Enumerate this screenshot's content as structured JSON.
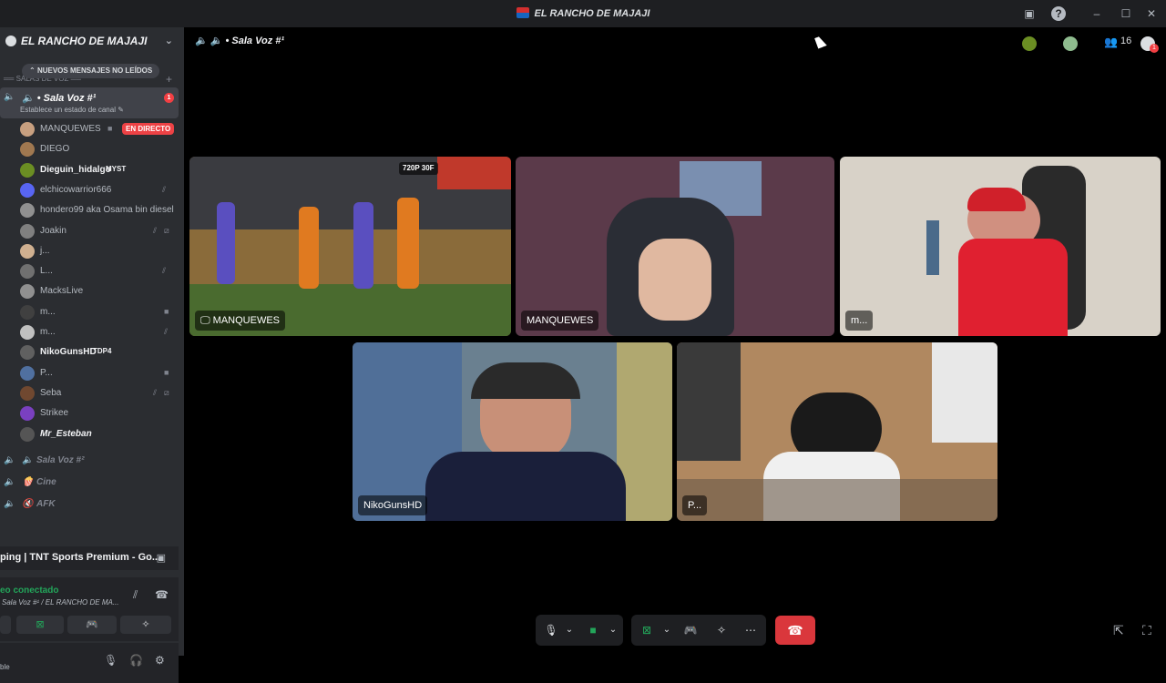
{
  "window": {
    "title": "EL RANCHO DE MAJAJI"
  },
  "sidebar": {
    "server_name": "EL RANCHO DE MAJAJI",
    "new_messages_pill": "NUEVOS MENSAJES NO LEÍDOS",
    "category": "SALAS DE VOZ",
    "active_channel": {
      "name": "Sala Voz #¹",
      "status_hint": "Establece un estado de canal",
      "badge": "1"
    },
    "members": [
      {
        "name": "MANQUEWES",
        "live": "EN DIRECTO"
      },
      {
        "name": "DIEGO"
      },
      {
        "name": "Dieguin_hidalgo",
        "tag": "MYST"
      },
      {
        "name": "elchicowarrior666"
      },
      {
        "name": "hondero99 aka Osama bin diesel"
      },
      {
        "name": "Joakin"
      },
      {
        "name": "j..."
      },
      {
        "name": "L..."
      },
      {
        "name": "MacksLive"
      },
      {
        "name": "m..."
      },
      {
        "name": "m..."
      },
      {
        "name": "NikoGunsHD",
        "tag": "TDP4"
      },
      {
        "name": "P..."
      },
      {
        "name": "Seba"
      },
      {
        "name": "Strikee"
      },
      {
        "name": "Mr_Esteban"
      }
    ],
    "other_channels": [
      {
        "name": "Sala Voz #²"
      },
      {
        "name": "Cine"
      },
      {
        "name": "AFK"
      }
    ],
    "activity": "ping | TNT Sports Premium - Go...",
    "voice": {
      "status": "eo conectado",
      "location": "Sala Voz #¹ / EL RANCHO DE MA..."
    },
    "user_status": "ble"
  },
  "topbar": {
    "channel": "Sala Voz #¹",
    "participant_count": "16",
    "notif_badge": "1"
  },
  "tiles": [
    {
      "label": "MANQUEWES",
      "overlay": "720P 30F"
    },
    {
      "label": "MANQUEWES"
    },
    {
      "label": "m..."
    },
    {
      "label": "NikoGunsHD"
    },
    {
      "label": "P..."
    }
  ],
  "colors": {
    "accent_red": "#da373c",
    "online_green": "#23a55a",
    "live_red": "#ed4245"
  }
}
